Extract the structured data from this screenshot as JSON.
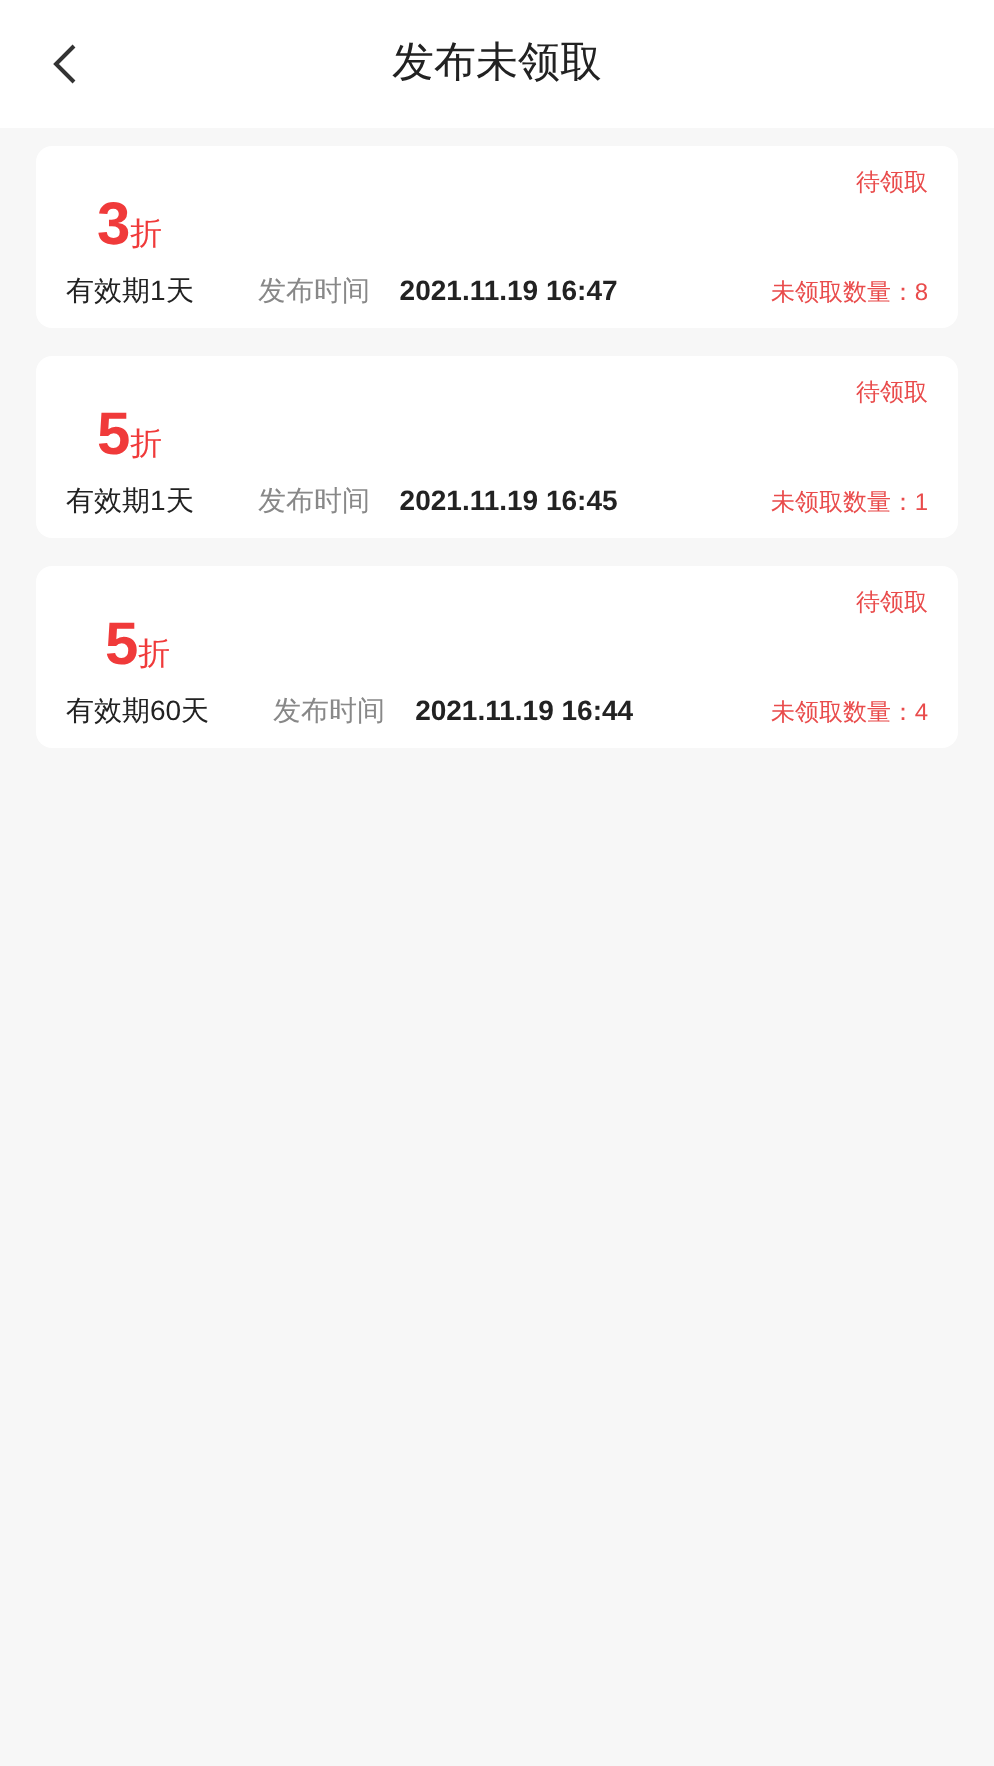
{
  "header": {
    "title": "发布未领取"
  },
  "coupons": [
    {
      "discount": "3",
      "unit": "折",
      "status": "待领取",
      "validity": "有效期1天",
      "time_label": "发布时间",
      "time": "2021.11.19 16:47",
      "count": "未领取数量：8"
    },
    {
      "discount": "5",
      "unit": "折",
      "status": "待领取",
      "validity": "有效期1天",
      "time_label": "发布时间",
      "time": "2021.11.19 16:45",
      "count": "未领取数量：1"
    },
    {
      "discount": "5",
      "unit": "折",
      "status": "待领取",
      "validity": "有效期60天",
      "time_label": "发布时间",
      "time": "2021.11.19 16:44",
      "count": "未领取数量：4"
    }
  ]
}
